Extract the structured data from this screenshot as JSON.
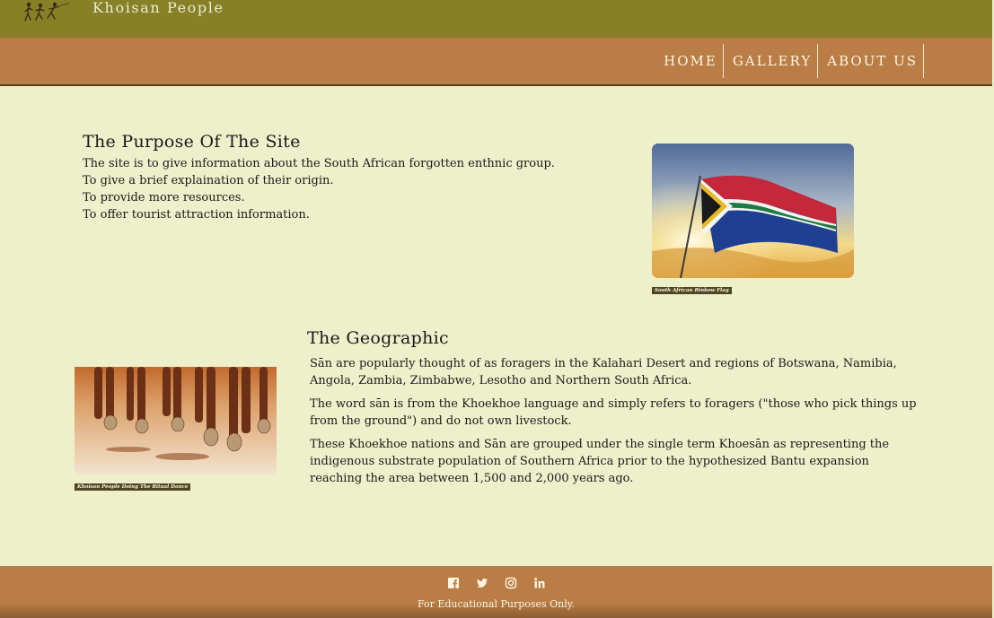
{
  "header": {
    "site_title": "Khoisan People"
  },
  "nav": {
    "items": [
      {
        "label": "HOME"
      },
      {
        "label": "GALLERY"
      },
      {
        "label": "ABOUT US"
      }
    ]
  },
  "purpose": {
    "heading": "The Purpose Of The Site",
    "lines": [
      "The site is to give information about the South African forgotten enthnic group.",
      "To give a brief explaination of their origin.",
      "To provide more resources.",
      "To offer tourist attraction information."
    ],
    "image_caption": "South African Rinbow Flag"
  },
  "geographic": {
    "heading": "The Geographic",
    "paragraphs": [
      "Sān are popularly thought of as foragers in the Kalahari Desert and regions of Botswana, Namibia, Angola, Zambia, Zimbabwe, Lesotho and Northern South Africa.",
      "The word sān is from the Khoekhoe language and simply refers to foragers (\"those who pick things up from the ground\") and do not own livestock.",
      "These Khoekhoe nations and Sān are grouped under the single term Khoesān as representing the indigenous substrate population of Southern Africa prior to the hypothesized Bantu expansion reaching the area between 1,500 and 2,000 years ago."
    ],
    "image_caption": "Khoisan People Doing The Ritual Dance"
  },
  "footer": {
    "social_icons": [
      "facebook-icon",
      "twitter-icon",
      "instagram-icon",
      "linkedin-icon"
    ],
    "text": "For Educational Purposes Only."
  },
  "colors": {
    "topbar": "#878026",
    "navbar": "#b97d45",
    "background": "#eef0cb",
    "caption_bg": "#4f4522"
  }
}
